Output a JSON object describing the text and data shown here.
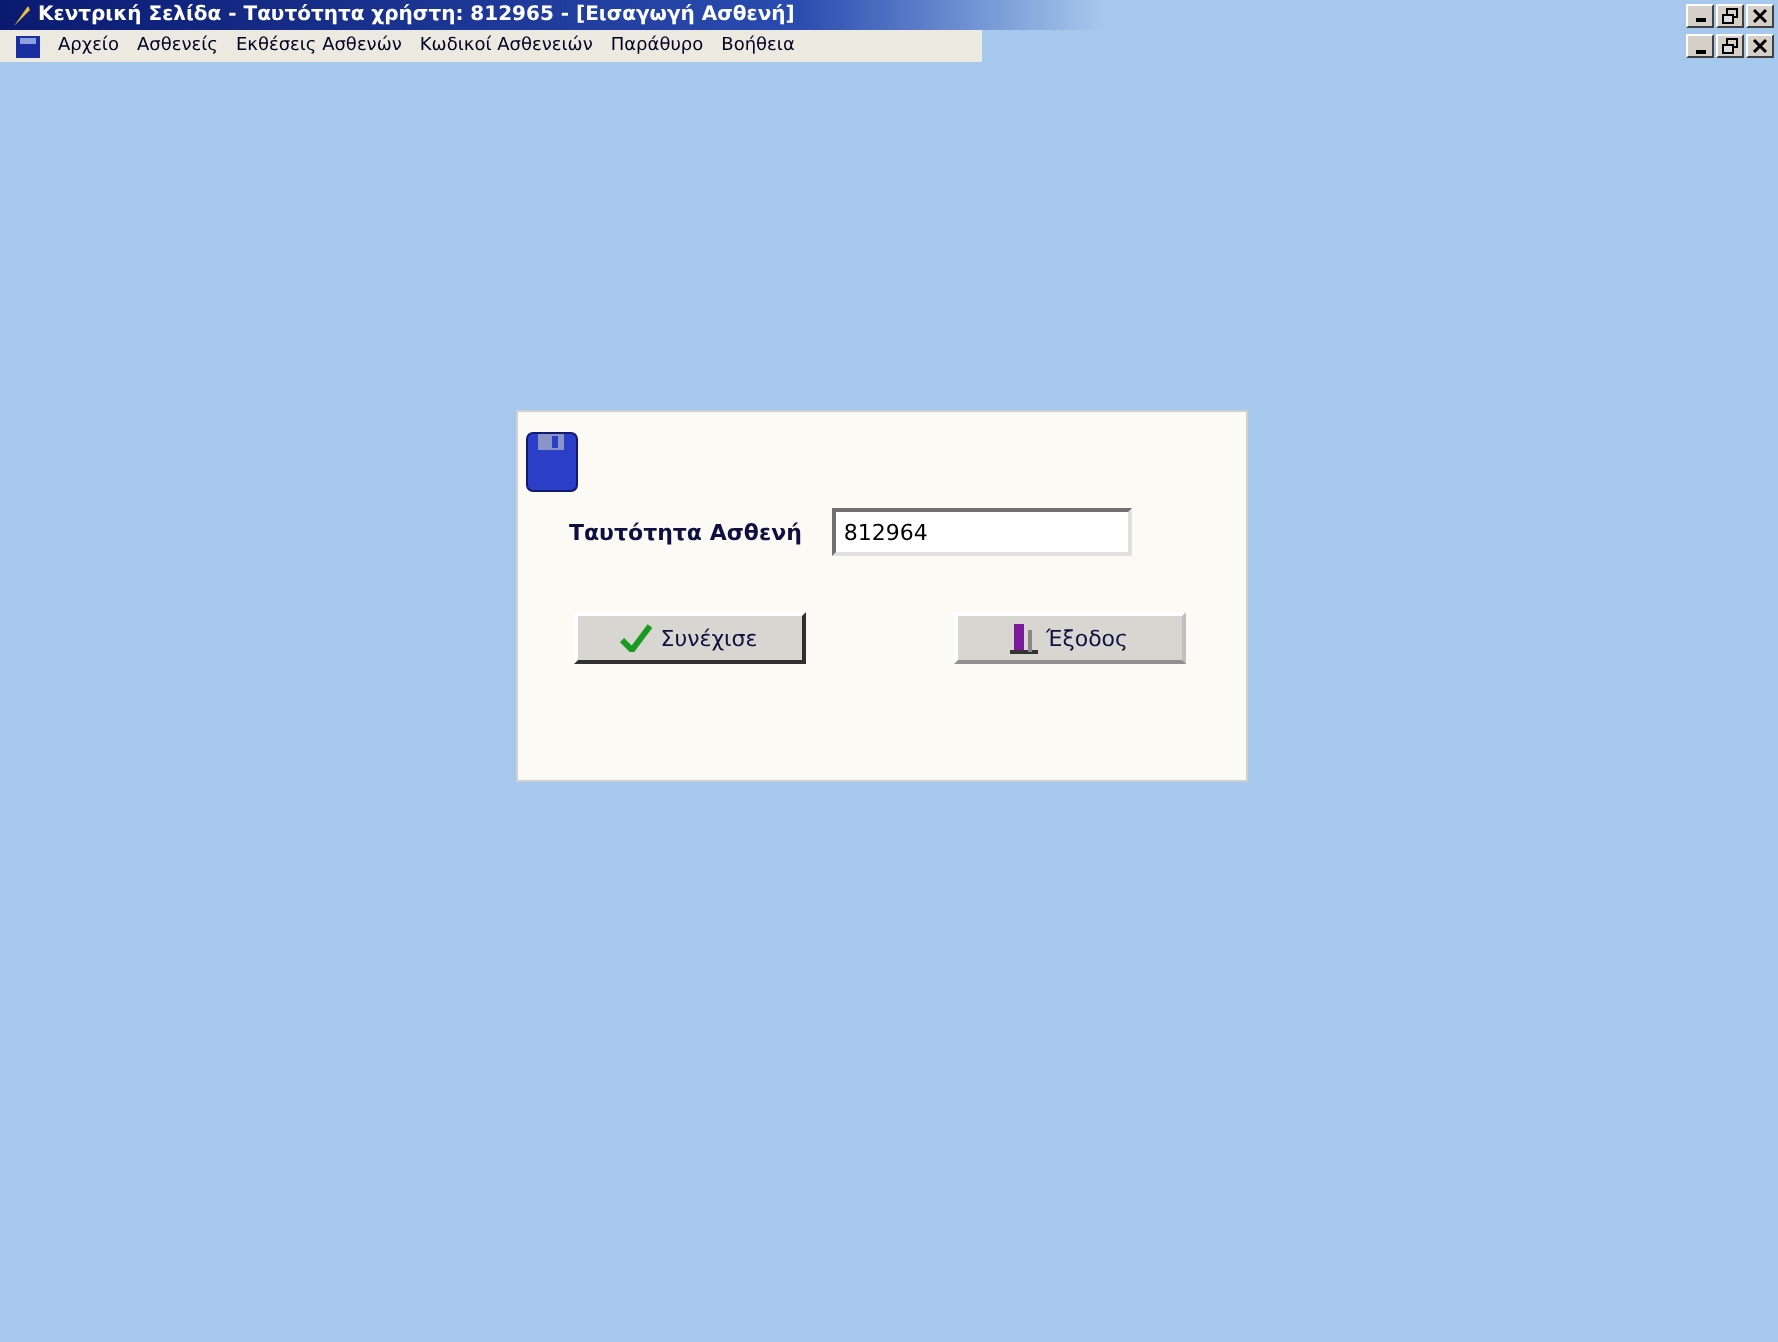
{
  "window": {
    "title": "Κεντρική Σελίδα - Ταυτότητα χρήστη: 812965 - [Εισαγωγή Ασθενή]"
  },
  "menu": [
    "Αρχείο",
    "Ασθενείς",
    "Εκθέσεις Ασθενών",
    "Κωδικοί Ασθενειών",
    "Παράθυρο",
    "Βοήθεια"
  ],
  "dialog": {
    "field_label": "Ταυτότητα Ασθενή",
    "field_value": "812964",
    "buttons": [
      {
        "kind": "continue",
        "label": "Συνέχισε"
      },
      {
        "kind": "exit",
        "label": "Έξοδος"
      }
    ]
  }
}
